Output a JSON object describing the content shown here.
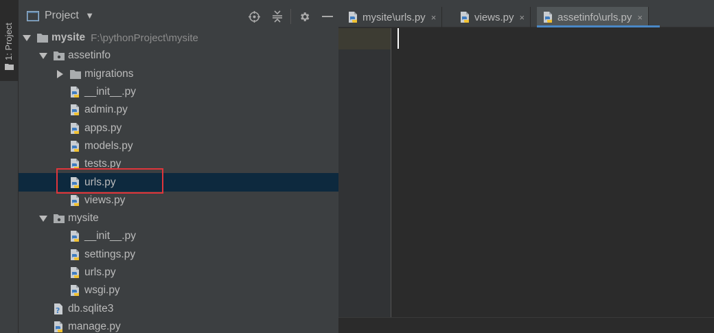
{
  "toolstrip": {
    "project_tab_label": "1: Project"
  },
  "project_panel": {
    "title": "Project",
    "tree": [
      {
        "type": "root",
        "name": "mysite",
        "path": "F:\\pythonProject\\mysite",
        "depth": 0,
        "expanded": true
      },
      {
        "type": "package",
        "name": "assetinfo",
        "depth": 1,
        "expanded": true
      },
      {
        "type": "folder",
        "name": "migrations",
        "depth": 2,
        "expanded": false
      },
      {
        "type": "py",
        "name": "__init__.py",
        "depth": 2
      },
      {
        "type": "py",
        "name": "admin.py",
        "depth": 2
      },
      {
        "type": "py",
        "name": "apps.py",
        "depth": 2
      },
      {
        "type": "py",
        "name": "models.py",
        "depth": 2
      },
      {
        "type": "py",
        "name": "tests.py",
        "depth": 2
      },
      {
        "type": "py",
        "name": "urls.py",
        "depth": 2,
        "selected": true
      },
      {
        "type": "py",
        "name": "views.py",
        "depth": 2
      },
      {
        "type": "package",
        "name": "mysite",
        "depth": 1,
        "expanded": true
      },
      {
        "type": "py",
        "name": "__init__.py",
        "depth": 2
      },
      {
        "type": "py",
        "name": "settings.py",
        "depth": 2
      },
      {
        "type": "py",
        "name": "urls.py",
        "depth": 2
      },
      {
        "type": "py",
        "name": "wsgi.py",
        "depth": 2
      },
      {
        "type": "db",
        "name": "db.sqlite3",
        "depth": 1
      },
      {
        "type": "py",
        "name": "manage.py",
        "depth": 1
      }
    ]
  },
  "editor": {
    "tabs": [
      {
        "label": "mysite\\urls.py",
        "active": false
      },
      {
        "label": "views.py",
        "active": false
      },
      {
        "label": "assetinfo\\urls.py",
        "active": true
      }
    ],
    "close_glyph": "×"
  },
  "colors": {
    "background": "#3c3f41",
    "editor_bg": "#2b2b2b",
    "selection": "#0d293e",
    "highlight_border": "#e0353b",
    "tab_accent": "#4a88c7"
  }
}
